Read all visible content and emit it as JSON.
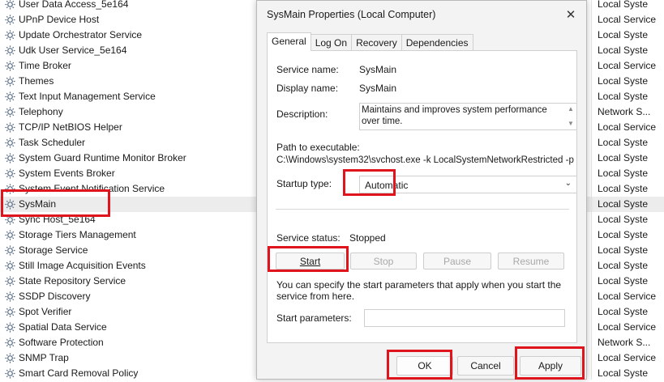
{
  "services": [
    {
      "name": "User Data Access_5e164",
      "logon": "Local Syste"
    },
    {
      "name": "UPnP Device Host",
      "logon": "Local Service"
    },
    {
      "name": "Update Orchestrator Service",
      "logon": "Local Syste"
    },
    {
      "name": "Udk User Service_5e164",
      "logon": "Local Syste"
    },
    {
      "name": "Time Broker",
      "logon": "Local Service"
    },
    {
      "name": "Themes",
      "logon": "Local Syste"
    },
    {
      "name": "Text Input Management Service",
      "logon": "Local Syste"
    },
    {
      "name": "Telephony",
      "logon": "Network S..."
    },
    {
      "name": "TCP/IP NetBIOS Helper",
      "logon": "Local Service"
    },
    {
      "name": "Task Scheduler",
      "logon": "Local Syste"
    },
    {
      "name": "System Guard Runtime Monitor Broker",
      "logon": "Local Syste"
    },
    {
      "name": "System Events Broker",
      "logon": "Local Syste"
    },
    {
      "name": "System Event Notification Service",
      "logon": "Local Syste"
    },
    {
      "name": "SysMain",
      "logon": "Local Syste"
    },
    {
      "name": "Sync Host_5e164",
      "logon": "Local Syste"
    },
    {
      "name": "Storage Tiers Management",
      "logon": "Local Syste"
    },
    {
      "name": "Storage Service",
      "logon": "Local Syste"
    },
    {
      "name": "Still Image Acquisition Events",
      "logon": "Local Syste"
    },
    {
      "name": "State Repository Service",
      "logon": "Local Syste"
    },
    {
      "name": "SSDP Discovery",
      "logon": "Local Service"
    },
    {
      "name": "Spot Verifier",
      "logon": "Local Syste"
    },
    {
      "name": "Spatial Data Service",
      "logon": "Local Service"
    },
    {
      "name": "Software Protection",
      "logon": "Network S..."
    },
    {
      "name": "SNMP Trap",
      "logon": "Local Service"
    },
    {
      "name": "Smart Card Removal Policy",
      "logon": "Local Syste"
    }
  ],
  "selected_service": "SysMain",
  "dialog": {
    "title": "SysMain Properties (Local Computer)",
    "close_icon": "close-icon",
    "tabs": [
      "General",
      "Log On",
      "Recovery",
      "Dependencies"
    ],
    "active_tab": "General",
    "service_name_label": "Service name:",
    "service_name": "SysMain",
    "display_name_label": "Display name:",
    "display_name": "SysMain",
    "description_label": "Description:",
    "description": "Maintains and improves system performance over time.",
    "path_label": "Path to executable:",
    "path": "C:\\Windows\\system32\\svchost.exe -k LocalSystemNetworkRestricted -p",
    "startup_type_label": "Startup type:",
    "startup_type": "Automatic",
    "service_status_label": "Service status:",
    "service_status": "Stopped",
    "buttons": {
      "start": "Start",
      "stop": "Stop",
      "pause": "Pause",
      "resume": "Resume"
    },
    "hint": "You can specify the start parameters that apply when you start the service from here.",
    "start_params_label": "Start parameters:",
    "start_params_value": "",
    "footer": {
      "ok": "OK",
      "cancel": "Cancel",
      "apply": "Apply"
    }
  },
  "colors": {
    "highlight": "#e0141c",
    "gear_icon": "#5a6e86"
  }
}
